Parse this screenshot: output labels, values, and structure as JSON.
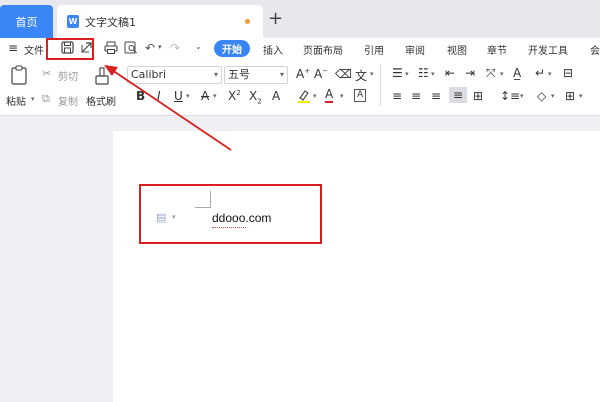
{
  "tabs": {
    "home_label": "首页",
    "doc_icon": "W",
    "doc_label": "文字文稿1",
    "add": "+"
  },
  "menu": {
    "hamburger": "≡",
    "file": "文件",
    "start": "开始",
    "items": [
      "插入",
      "页面布局",
      "引用",
      "审阅",
      "视图",
      "章节",
      "开发工具",
      "会"
    ]
  },
  "toolbar": {
    "paste": "粘贴",
    "cut": "剪切",
    "copy": "复制",
    "format_painter": "格式刷",
    "font_name": "Calibri",
    "font_size": "五号"
  },
  "document": {
    "text": "ddooo.com"
  },
  "colors": {
    "accent": "#3a86f7",
    "highlight_red": "#d9201f"
  }
}
